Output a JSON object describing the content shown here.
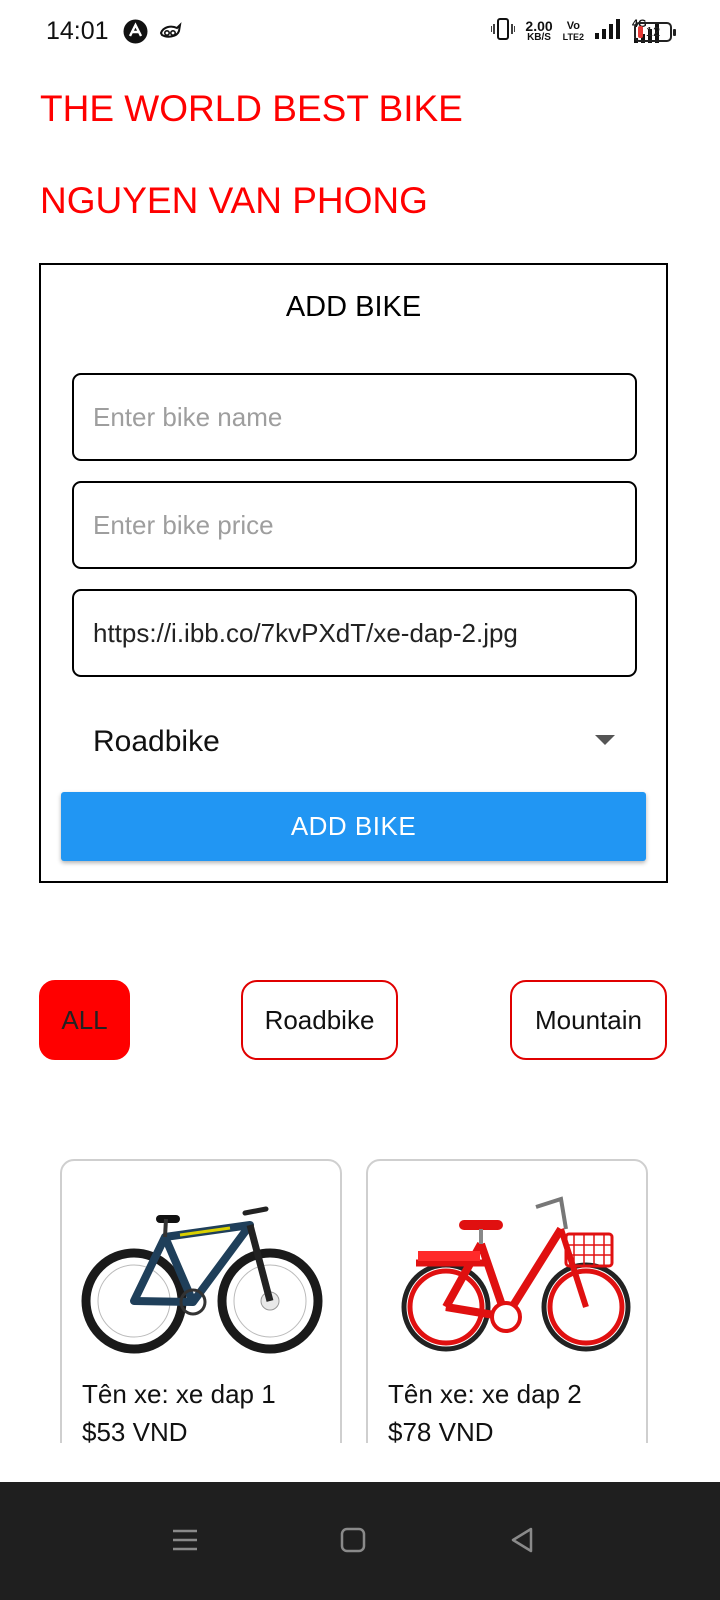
{
  "status_bar": {
    "time": "14:01",
    "net_speed_value": "2.00",
    "net_speed_unit": "KB/S",
    "volte_top": "Vo",
    "volte_bottom": "LTE2",
    "network_label": "4G",
    "battery_level": "12",
    "icons": [
      "app-notification-icon",
      "bird-icon",
      "vibrate-icon",
      "signal-icon",
      "signal-4g-icon",
      "battery-icon"
    ]
  },
  "header": {
    "title": "THE WORLD BEST BIKE",
    "author": "NGUYEN VAN PHONG",
    "color": "#ff0000"
  },
  "form": {
    "heading": "ADD BIKE",
    "name_placeholder": "Enter bike name",
    "name_value": "",
    "price_placeholder": "Enter bike price",
    "price_value": "",
    "image_url_value": "https://i.ibb.co/7kvPXdT/xe-dap-2.jpg",
    "type_selected": "Roadbike",
    "submit_label": "ADD BIKE",
    "submit_color": "#2196f3"
  },
  "filters": {
    "items": [
      "ALL",
      "Roadbike",
      "Mountain"
    ],
    "active": "ALL",
    "active_color": "#ff0000"
  },
  "products": [
    {
      "name": "Tên xe: xe dap 1",
      "price": "$53 VND",
      "image": "mountain-bike-image"
    },
    {
      "name": "Tên xe: xe dap 2",
      "price": "$78 VND",
      "image": "red-city-bike-image"
    }
  ],
  "nav_bar": {
    "buttons": [
      "menu-icon",
      "home-square-icon",
      "back-triangle-icon"
    ]
  }
}
